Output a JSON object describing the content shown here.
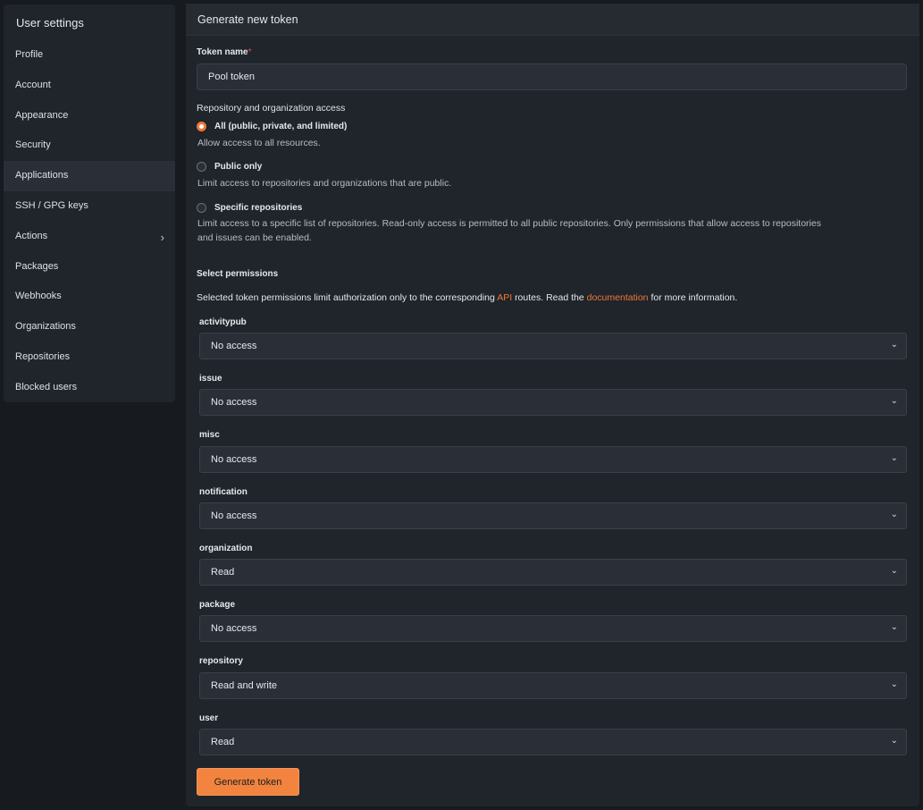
{
  "sidebar": {
    "title": "User settings",
    "items": [
      {
        "label": "Profile"
      },
      {
        "label": "Account"
      },
      {
        "label": "Appearance"
      },
      {
        "label": "Security"
      },
      {
        "label": "Applications"
      },
      {
        "label": "SSH / GPG keys"
      },
      {
        "label": "Actions"
      },
      {
        "label": "Packages"
      },
      {
        "label": "Webhooks"
      },
      {
        "label": "Organizations"
      },
      {
        "label": "Repositories"
      },
      {
        "label": "Blocked users"
      }
    ],
    "active": "Applications"
  },
  "panel": {
    "title": "Generate new token",
    "token_name": {
      "label": "Token name",
      "required_mark": "*",
      "value": "Pool token"
    },
    "access": {
      "title": "Repository and organization access",
      "options": [
        {
          "label": "All (public, private, and limited)",
          "description": "Allow access to all resources.",
          "checked": true
        },
        {
          "label": "Public only",
          "description": "Limit access to repositories and organizations that are public.",
          "checked": false
        },
        {
          "label": "Specific repositories",
          "description_line1": "Limit access to a specific list of repositories. Read-only access is permitted to all public repositories. Only permissions that allow access to repositories",
          "description_line2": "and issues can be enabled.",
          "checked": false
        }
      ]
    },
    "permissions": {
      "title": "Select permissions",
      "info_prefix": "Selected token permissions limit authorization only to the corresponding",
      "info_api": "API",
      "info_middle": "routes. Read the",
      "info_doc": "documentation",
      "info_suffix": "for more information.",
      "items": [
        {
          "label": "activitypub",
          "value": "No access"
        },
        {
          "label": "issue",
          "value": "No access"
        },
        {
          "label": "misc",
          "value": "No access"
        },
        {
          "label": "notification",
          "value": "No access"
        },
        {
          "label": "organization",
          "value": "Read"
        },
        {
          "label": "package",
          "value": "No access"
        },
        {
          "label": "repository",
          "value": "Read and write"
        },
        {
          "label": "user",
          "value": "Read"
        }
      ]
    },
    "generate_button": "Generate token"
  },
  "colors": {
    "accent": "#ee7837",
    "button": "#f2843f",
    "background": "#171a1f",
    "panel": "#20242b"
  }
}
